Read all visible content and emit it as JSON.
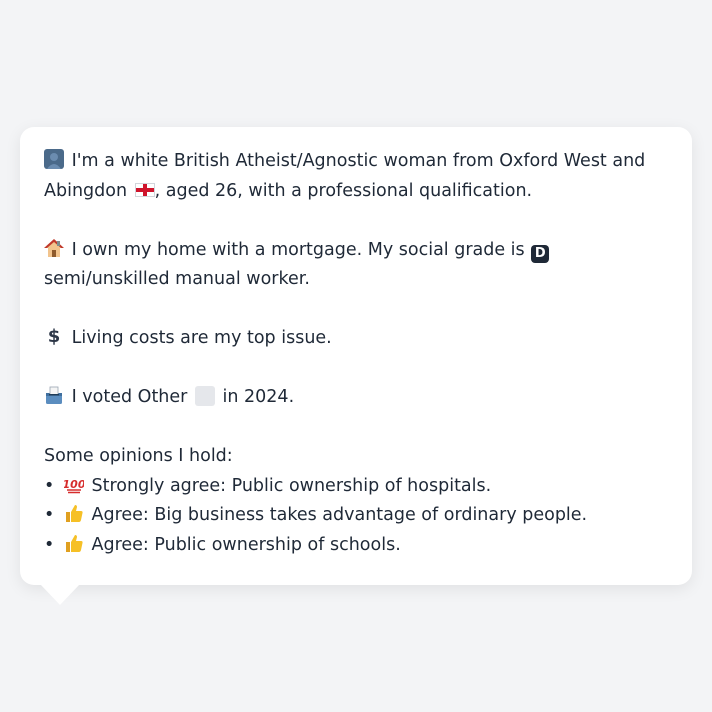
{
  "persona": {
    "line1_text": "I'm a white British Atheist/Agnostic woman from Oxford West and Abingdon",
    "line1_suffix": ", aged 26, with a professional qualification.",
    "home_text": "I own my home with a mortgage. My social grade is",
    "grade_badge": "D",
    "grade_suffix": "semi/unskilled manual worker.",
    "issue_text": "Living costs are my top issue.",
    "vote_prefix": "I voted Other",
    "vote_suffix": "in 2024.",
    "opinions_heading": "Some opinions I hold:",
    "opinions": [
      {
        "bullet": "•",
        "icon": "hundred-icon",
        "text": "Strongly agree: Public ownership of hospitals."
      },
      {
        "bullet": "•",
        "icon": "thumbs-up-icon",
        "text": "Agree: Big business takes advantage of ordinary people."
      },
      {
        "bullet": "•",
        "icon": "thumbs-up-icon",
        "text": "Agree: Public ownership of schools."
      }
    ]
  },
  "icons": {
    "person": "person-icon",
    "flag": "england-flag-icon",
    "house": "house-icon",
    "dollar": "dollar-icon",
    "ballot": "ballot-box-icon",
    "other_party_swatch": "gray-square-icon"
  },
  "colors": {
    "background": "#f3f4f6",
    "bubble": "#ffffff",
    "text": "#1f2937",
    "flag_red": "#cf142b",
    "swatch_gray": "#e5e7eb"
  }
}
